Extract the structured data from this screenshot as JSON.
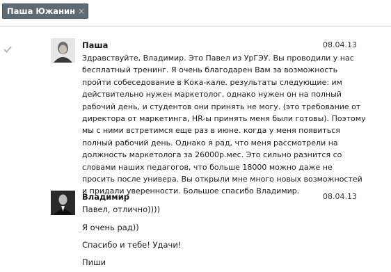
{
  "header": {
    "chip_label": "Паша Южанин",
    "chip_close": "×"
  },
  "messages": [
    {
      "author": "Паша",
      "date": "08.04.13",
      "lines": [
        "Здравствуйте, Владимир. Это Павел из УрГЭУ. Вы проводили у нас",
        "бесплатный тренинг. Я очень благодарен Вам за возможность",
        "пройти собеседование в Кока-кале. результаты следующие: им",
        "действительно нужен маркетолог, однако нужен он на полный",
        "рабочий день, и студентов они принять не могу. (это требование от",
        "директора от маркетинга, HR-ы принять меня были готовы). Поэтому",
        "мы с ними встретимся еще раз в июне. когда у меня появиться",
        "полный рабочий день. Однако я рад, что меня рассмотрели на",
        "должность маркетолога за 26000р.мес. Это сильно разнится со",
        "словами наших педагогов, что больше 18000 можно даже не",
        "просить после универа. Вы открыли мне много новых возможностей",
        "и придали уверенности. Большое спасибо Владимир."
      ]
    },
    {
      "author": "Владимир",
      "date": "08.04.13",
      "lines": [
        "Павел, отлично))))",
        "Я очень рад))",
        "Спасибо и тебе! Удачи!",
        "Пиши"
      ]
    }
  ]
}
